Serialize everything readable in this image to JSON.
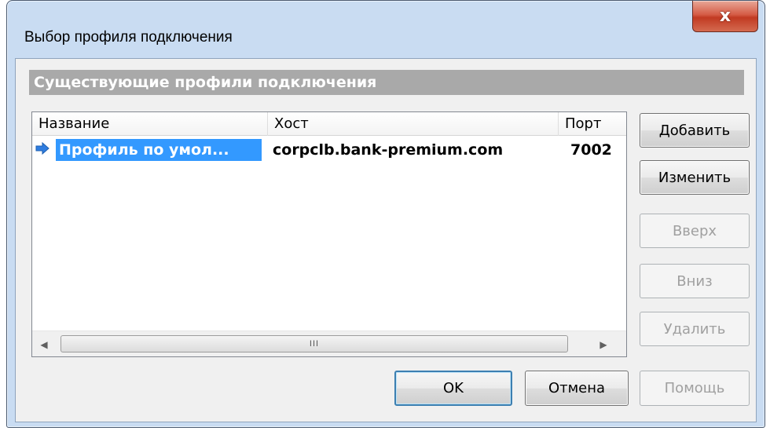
{
  "window": {
    "title": "Выбор профиля подключения",
    "close_label": "x"
  },
  "section": {
    "title": "Существующие профили подключения"
  },
  "table": {
    "columns": [
      "Название",
      "Хост",
      "Порт"
    ],
    "rows": [
      {
        "name": "Профиль по умол...",
        "host": "corpclb.bank-premium.com",
        "port": "7002",
        "selected": true
      }
    ],
    "scroll_thumb_label": "III"
  },
  "side_buttons": {
    "add": "Добавить",
    "edit": "Изменить",
    "up": "Вверх",
    "down": "Вниз",
    "delete": "Удалить"
  },
  "bottom_buttons": {
    "ok": "OK",
    "cancel": "Отмена",
    "help": "Помощь"
  },
  "icons": {
    "row_marker": "arrow-right-icon",
    "scroll_left": "chevron-left-icon",
    "scroll_right": "chevron-right-icon"
  },
  "colors": {
    "selection": "#3399ff",
    "header_band": "#a9a9a9",
    "close_button": "#c13a22"
  }
}
